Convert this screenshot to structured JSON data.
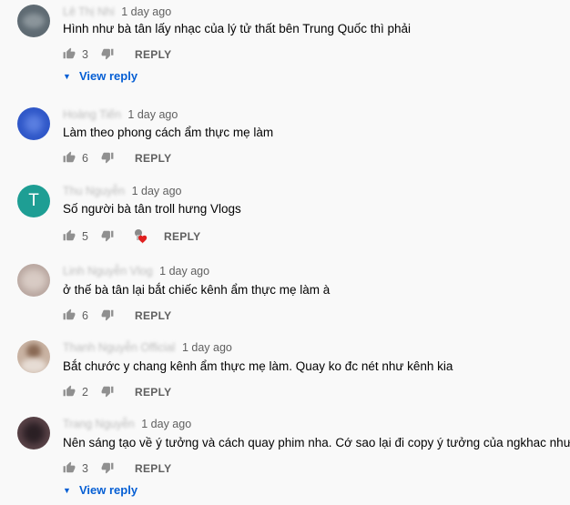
{
  "comments": [
    {
      "author": "Lê Thị Nhi",
      "time": "1 day ago",
      "text": "Hình như bà tân lấy nhạc của lý tử thất bên Trung Quốc thì phải",
      "likes": "3",
      "reply_label": "REPLY",
      "view_reply": "View reply",
      "avatar_color": "#5f6b73"
    },
    {
      "author": "Hoàng Tiến",
      "time": "1 day ago",
      "text": "Làm theo phong cách ẩm thực mẹ làm",
      "likes": "6",
      "reply_label": "REPLY",
      "avatar_color": "#2f57c8"
    },
    {
      "author": "Thu Nguyễn",
      "time": "1 day ago",
      "text": "Số người bà tân troll hưng Vlogs",
      "likes": "5",
      "reply_label": "REPLY",
      "avatar_letter": "T",
      "avatar_color": "#1e9e94"
    },
    {
      "author": "Linh Nguyễn Vlog",
      "time": "1 day ago",
      "text": "ở thế bà tân lại bắt chiếc kênh ẩm thực mẹ làm à",
      "likes": "6",
      "reply_label": "REPLY",
      "avatar_color": "#b9a7a0"
    },
    {
      "author": "Thanh Nguyễn Official",
      "time": "1 day ago",
      "text": "Bắt chước y chang kênh ẩm thực mẹ làm. Quay ko đc nét  như kênh kia",
      "likes": "2",
      "reply_label": "REPLY",
      "avatar_color": "#c9b3a3"
    },
    {
      "author": "Trang Nguyễn",
      "time": "1 day ago",
      "text": "Nên sáng tạo về ý tưởng và cách quay phim nha. Cớ sao lại đi copy ý tưởng của ngkhac như dậy",
      "likes": "3",
      "reply_label": "REPLY",
      "view_reply": "View reply",
      "avatar_color": "#5a4348"
    }
  ],
  "icons": {
    "like": "thumb-up-icon",
    "dislike": "thumb-down-icon",
    "expand": "triangle-down-icon",
    "creator_heart": "creator-heart-icon"
  },
  "colors": {
    "background": "#f9f9f9",
    "link": "#065fd4",
    "secondary_text": "#606060",
    "heart": "#e02020"
  }
}
